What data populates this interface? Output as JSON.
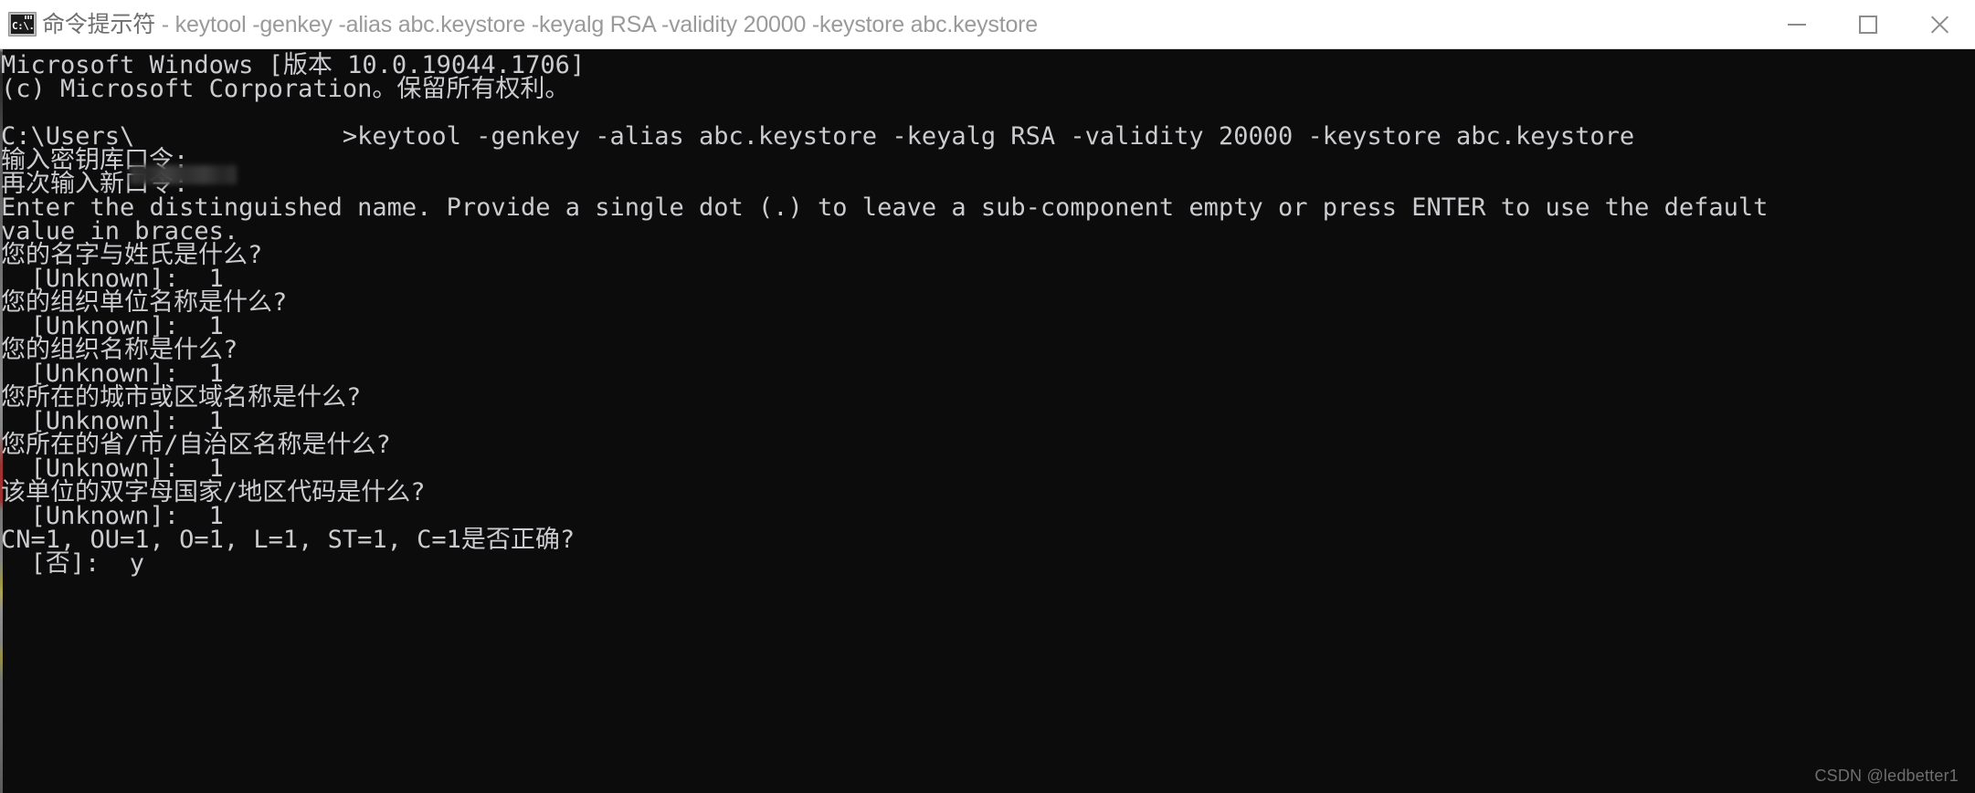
{
  "window": {
    "title_app": "命令提示符",
    "title_separator": " - ",
    "title_command": "keytool  -genkey -alias abc.keystore -keyalg RSA -validity 20000 -keystore abc.keystore",
    "icon_label": "C:\\.",
    "icon_name": "command-prompt-icon",
    "controls": {
      "minimize": "—",
      "maximize": "☐",
      "close": "✕"
    },
    "colors": {
      "titlebar_bg": "#ffffff",
      "titlebar_text": "#9a9a9a",
      "console_bg": "#0c0c0c",
      "console_text": "#ccccd0",
      "accent_red": "#c23636"
    }
  },
  "console": {
    "lines": [
      "Microsoft Windows [版本 10.0.19044.1706]",
      "(c) Microsoft Corporation。保留所有权利。",
      "",
      "C:\\Users\\              >keytool -genkey -alias abc.keystore -keyalg RSA -validity 20000 -keystore abc.keystore",
      "输入密钥库口令:",
      "再次输入新口令:",
      "Enter the distinguished name. Provide a single dot (.) to leave a sub-component empty or press ENTER to use the default",
      "value in braces.",
      "您的名字与姓氏是什么?",
      "  [Unknown]:  1",
      "您的组织单位名称是什么?",
      "  [Unknown]:  1",
      "您的组织名称是什么?",
      "  [Unknown]:  1",
      "您所在的城市或区域名称是什么?",
      "  [Unknown]:  1",
      "您所在的省/市/自治区名称是什么?",
      "  [Unknown]:  1",
      "该单位的双字母国家/地区代码是什么?",
      "  [Unknown]:  1",
      "CN=1, OU=1, O=1, L=1, ST=1, C=1是否正确?",
      "  [否]:  y"
    ],
    "redacted_username_placeholder": ""
  },
  "watermark": {
    "text": "CSDN @ledbetter1"
  }
}
